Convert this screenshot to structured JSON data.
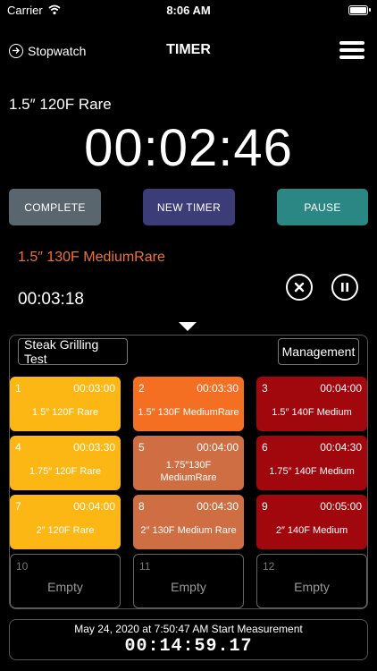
{
  "status": {
    "carrier": "Carrier",
    "time": "8:06 AM",
    "wifi_icon": "wifi-icon",
    "battery_icon": "battery-icon"
  },
  "nav": {
    "back_label": "Stopwatch",
    "title": "TIMER",
    "menu_icon": "hamburger-icon",
    "back_icon": "arrow-circle-icon"
  },
  "current": {
    "label": "1.5″ 120F Rare",
    "time": "00:02:46"
  },
  "controls": {
    "complete": {
      "label": "COMPLETE",
      "color": "#5a666e"
    },
    "new_timer": {
      "label": "NEW TIMER",
      "color": "#3c3c78"
    },
    "pause": {
      "label": "PAUSE",
      "color": "#2b8784"
    }
  },
  "next": {
    "label": "1.5″ 130F MediumRare",
    "time": "00:03:18",
    "color": "#f07236"
  },
  "panel": {
    "test_name": "Steak Grilling Test",
    "management_label": "Management"
  },
  "cells": [
    {
      "num": "1",
      "time": "00:03:00",
      "name": "1.5″ 120F Rare",
      "color": "#fdb714"
    },
    {
      "num": "2",
      "time": "00:03:30",
      "name": "1.5″ 130F MediumRare",
      "color": "#f46f22"
    },
    {
      "num": "3",
      "time": "00:04:00",
      "name": "1.5″ 140F Medium",
      "color": "#a1080e"
    },
    {
      "num": "4",
      "time": "00:03:30",
      "name": "1.75″ 120F Rare",
      "color": "#fdb714"
    },
    {
      "num": "5",
      "time": "00:04:00",
      "name": "1.75″130F MediumRare",
      "color": "#cf6e43"
    },
    {
      "num": "6",
      "time": "00:04:30",
      "name": "1.75″ 140F Medium",
      "color": "#a1080e"
    },
    {
      "num": "7",
      "time": "00:04:00",
      "name": "2″ 120F Rare",
      "color": "#fdb714"
    },
    {
      "num": "8",
      "time": "00:04:30",
      "name": "2″ 130F Medium Rare",
      "color": "#cf6e43"
    },
    {
      "num": "9",
      "time": "00:05:00",
      "name": "2″ 140F Medium",
      "color": "#a1080e"
    },
    {
      "num": "10",
      "time": "",
      "name": "Empty",
      "color": ""
    },
    {
      "num": "11",
      "time": "",
      "name": "Empty",
      "color": ""
    },
    {
      "num": "12",
      "time": "",
      "name": "Empty",
      "color": ""
    }
  ],
  "footer": {
    "start_text": "May 24, 2020 at 7:50:47 AM Start Measurement",
    "elapsed": "00:14:59.17"
  }
}
